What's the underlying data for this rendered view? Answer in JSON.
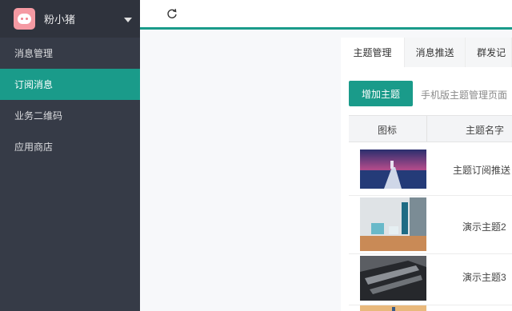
{
  "sidebar": {
    "brand_name": "粉小猪",
    "items": [
      {
        "label": "消息管理",
        "active": false
      },
      {
        "label": "订阅消息",
        "active": true
      },
      {
        "label": "业务二维码",
        "active": false
      },
      {
        "label": "应用商店",
        "active": false
      }
    ]
  },
  "topbar": {
    "refresh_icon": "refresh-icon"
  },
  "colors": {
    "accent": "#1a9b8a",
    "sidebar_bg": "#363b47",
    "avatar": "#f59aa3"
  },
  "tabs": [
    {
      "label": "主题管理",
      "active": true
    },
    {
      "label": "消息推送",
      "active": false
    },
    {
      "label": "群发记",
      "active": false
    }
  ],
  "actions": {
    "add_topic_label": "增加主题",
    "hint_text": "手机版主题管理页面"
  },
  "table": {
    "headers": [
      "图标",
      "主题名字"
    ],
    "rows": [
      {
        "name": "主题订阅推送"
      },
      {
        "name": "演示主题2"
      },
      {
        "name": "演示主题3"
      },
      {
        "name": ""
      }
    ]
  }
}
